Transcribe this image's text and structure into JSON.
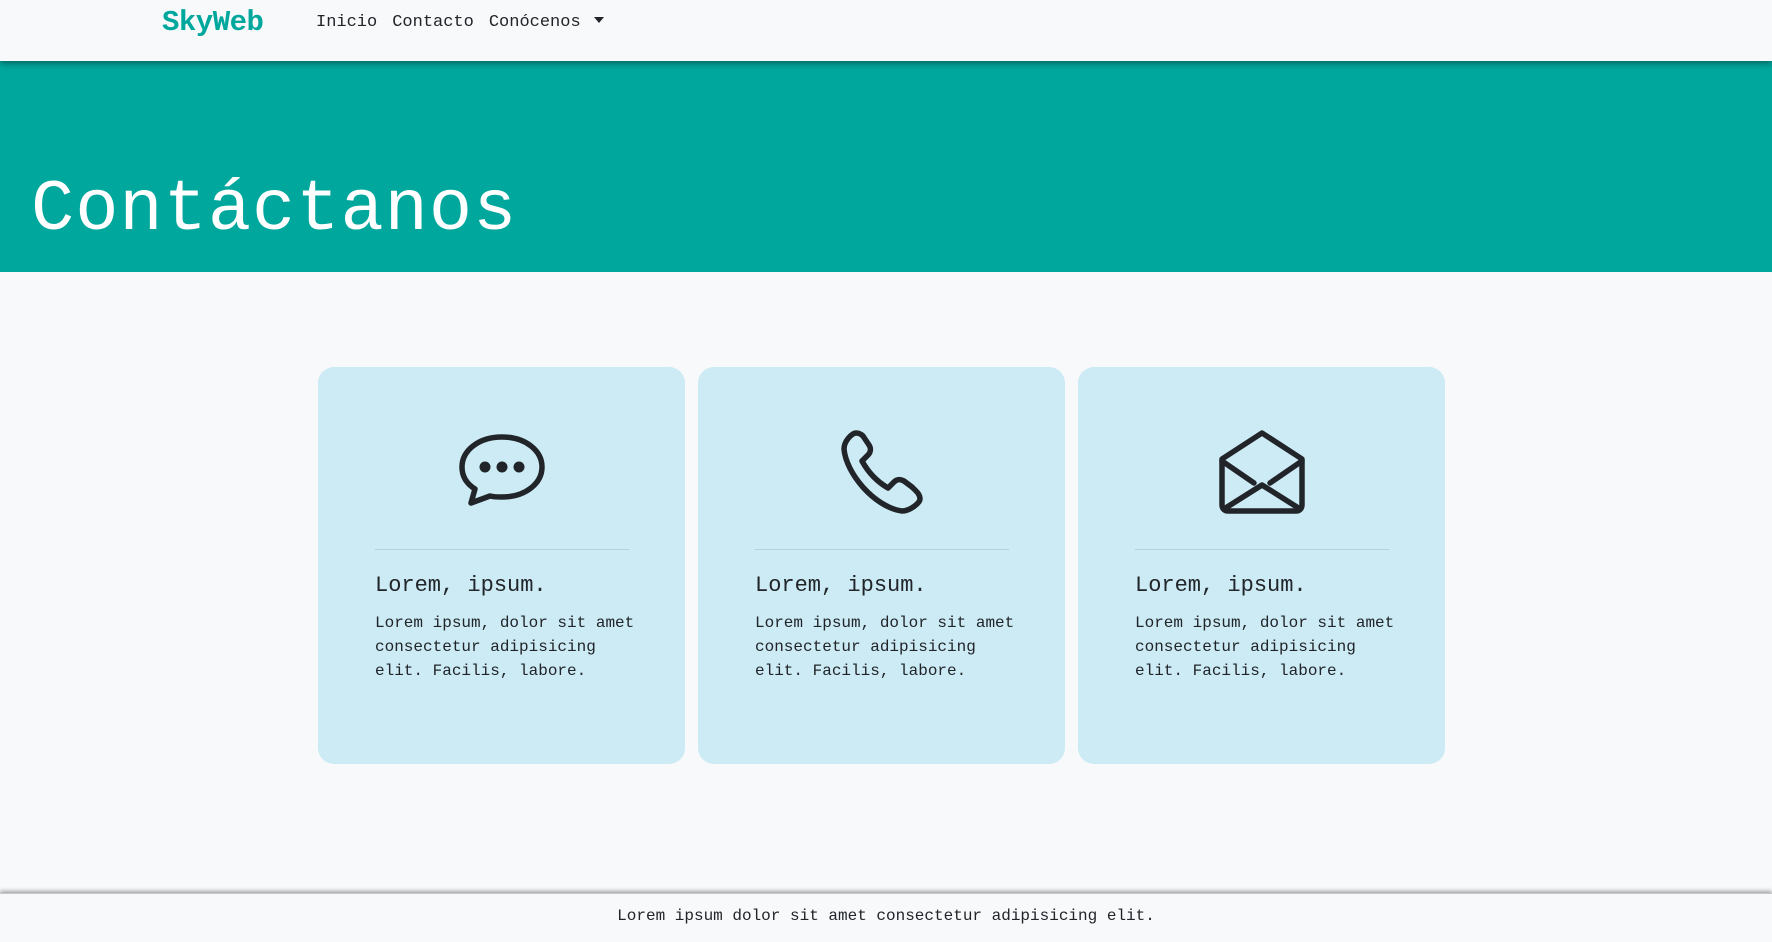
{
  "nav": {
    "brand": "SkyWeb",
    "links": [
      {
        "label": "Inicio"
      },
      {
        "label": "Contacto"
      },
      {
        "label": "Conócenos",
        "icon": "caret-down-icon"
      }
    ]
  },
  "hero": {
    "title": "Contáctanos"
  },
  "cards": [
    {
      "icon": "chat-dots-icon",
      "title": "Lorem, ipsum.",
      "text": "Lorem ipsum, dolor sit amet consectetur adipisicing elit. Facilis, labore."
    },
    {
      "icon": "phone-icon",
      "title": "Lorem, ipsum.",
      "text": "Lorem ipsum, dolor sit amet consectetur adipisicing elit. Facilis, labore."
    },
    {
      "icon": "envelope-open-icon",
      "title": "Lorem, ipsum.",
      "text": "Lorem ipsum, dolor sit amet consectetur adipisicing elit. Facilis, labore."
    }
  ],
  "footer": {
    "text": "Lorem ipsum dolor sit amet consectetur adipisicing elit."
  },
  "colors": {
    "accent": "#00a79d",
    "card_bg": "#cdebf5",
    "page_bg": "#f8f9fa",
    "text": "#212529"
  }
}
